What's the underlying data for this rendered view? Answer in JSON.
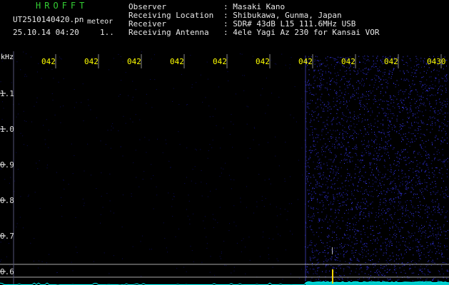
{
  "header": {
    "brand": "HROFFT",
    "filename": "UT2510140420.pn",
    "file_suffix": "meteor",
    "datetime": "25.10.14 04:20",
    "extra": "1..",
    "meta": [
      {
        "key": "Observer",
        "value": ": Masaki Kano"
      },
      {
        "key": "Receiving Location",
        "value": ": Shibukawa, Gunma, Japan"
      },
      {
        "key": "Receiver",
        "value": ": SDR# 43dB L15 111.6MHz USB"
      },
      {
        "key": "Receiving Antenna",
        "value": ": 4ele Yagi Az 230 for Kansai VOR"
      }
    ]
  },
  "spectrogram": {
    "y_unit": "kHz",
    "y_ticks": [
      "1.1",
      "1.0",
      "0.9",
      "0.8",
      "0.7",
      "0.6"
    ],
    "x_ticks": [
      "042",
      "042",
      "042",
      "042",
      "042",
      "042",
      "042",
      "042",
      "042",
      "0430"
    ],
    "colors": {
      "background": "#000000",
      "noise_dim": "#0b0b55",
      "noise_bright": "#3c3cff",
      "baseline": "#00ffff",
      "echo": "#ffd700",
      "axis": "#ffffff",
      "tick_label": "#ffff00",
      "grid": "#222244"
    }
  }
}
